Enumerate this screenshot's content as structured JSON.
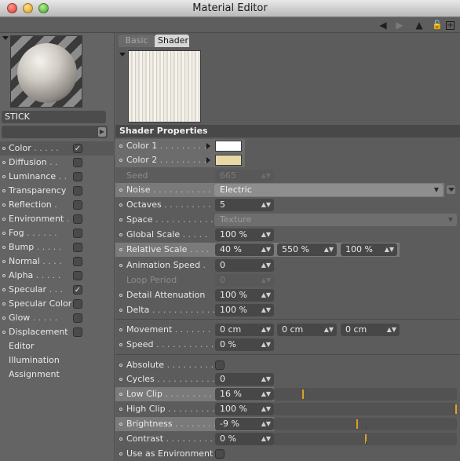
{
  "window": {
    "title": "Material Editor"
  },
  "toolbar": {
    "icons": [
      "arrow-left-icon",
      "arrow-right-icon",
      "arrow-up-icon",
      "lock-icon",
      "new-window-icon"
    ]
  },
  "material": {
    "name": "STICK"
  },
  "channels": [
    {
      "label": "Color",
      "checked": true,
      "selected": true
    },
    {
      "label": "Diffusion",
      "checked": false
    },
    {
      "label": "Luminance",
      "checked": false
    },
    {
      "label": "Transparency",
      "checked": false
    },
    {
      "label": "Reflection",
      "checked": false
    },
    {
      "label": "Environment",
      "checked": false
    },
    {
      "label": "Fog",
      "checked": false
    },
    {
      "label": "Bump",
      "checked": false
    },
    {
      "label": "Normal",
      "checked": false
    },
    {
      "label": "Alpha",
      "checked": false
    },
    {
      "label": "Specular",
      "checked": true
    },
    {
      "label": "Specular Color",
      "checked": false
    },
    {
      "label": "Glow",
      "checked": false
    },
    {
      "label": "Displacement",
      "checked": false
    }
  ],
  "extra_items": [
    "Editor",
    "Illumination",
    "Assignment"
  ],
  "tabs": {
    "basic": "Basic",
    "shader": "Shader"
  },
  "section_title": "Shader Properties",
  "props": {
    "color1": {
      "label": "Color 1",
      "color": "#ffffff"
    },
    "color2": {
      "label": "Color 2",
      "color": "#e7d8a6"
    },
    "seed": {
      "label": "Seed",
      "value": "665"
    },
    "noise": {
      "label": "Noise",
      "value": "Electric"
    },
    "octaves": {
      "label": "Octaves",
      "value": "5"
    },
    "space": {
      "label": "Space",
      "value": "Texture"
    },
    "global_scale": {
      "label": "Global Scale",
      "value": "100 %"
    },
    "relative_scale": {
      "label": "Relative Scale",
      "values": [
        "40 %",
        "550 %",
        "100 %"
      ]
    },
    "animation_speed": {
      "label": "Animation Speed",
      "value": "0"
    },
    "loop_period": {
      "label": "Loop Period",
      "value": "0"
    },
    "detail_attenuation": {
      "label": "Detail Attenuation",
      "value": "100 %"
    },
    "delta": {
      "label": "Delta",
      "value": "100 %"
    },
    "movement": {
      "label": "Movement",
      "values": [
        "0 cm",
        "0 cm",
        "0 cm"
      ]
    },
    "speed": {
      "label": "Speed",
      "value": "0 %"
    },
    "absolute": {
      "label": "Absolute",
      "checked": false
    },
    "cycles": {
      "label": "Cycles",
      "value": "0"
    },
    "low_clip": {
      "label": "Low Clip",
      "value": "16 %",
      "level": 0.16
    },
    "high_clip": {
      "label": "High Clip",
      "value": "100 %",
      "level": 1.0
    },
    "brightness": {
      "label": "Brightness",
      "value": "-9 %",
      "level": -0.09
    },
    "contrast": {
      "label": "Contrast",
      "value": "0 %",
      "level": 0.0
    },
    "use_as_environment": {
      "label": "Use as Environment",
      "checked": false
    }
  },
  "colors": {
    "accent": "#e0a020",
    "panel": "#5c5c5c",
    "field": "#474747"
  }
}
